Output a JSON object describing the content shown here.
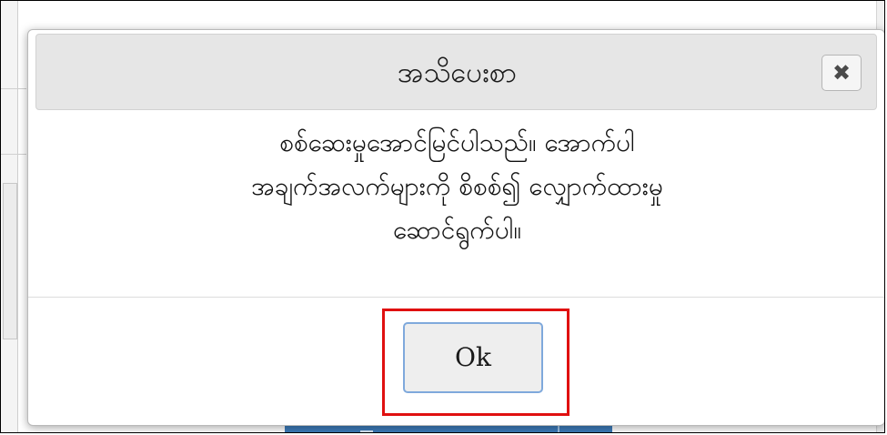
{
  "dialog": {
    "title": "အသိပေးစာ",
    "close_label": "✖",
    "message_lines": [
      "စစ်ဆေးမှုအောင်မြင်ပါသည်။ အောက်ပါ",
      "အချက်အလက်များကို စိစစ်၍ လျှောက်ထားမှု",
      "ဆောင်ရွက်ပါ။"
    ],
    "ok_label": "Ok"
  },
  "colors": {
    "header_bg": "#e6e6e6",
    "highlight": "#e01010",
    "ok_border": "#7fa9dc",
    "backdrop_button": "#3c7ab8"
  },
  "icons": {
    "close": "close-icon"
  }
}
